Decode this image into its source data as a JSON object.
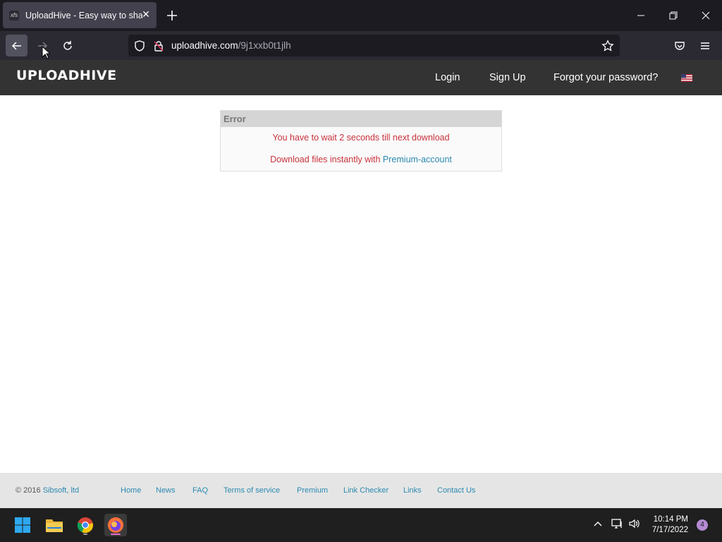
{
  "browser": {
    "tab": {
      "favicon": "xfs",
      "title": "UploadHive - Easy way to share"
    },
    "url": {
      "domain": "uploadhive.com",
      "path": "/9j1xxb0t1jlh"
    }
  },
  "site": {
    "logo": "UPLOADHIVE",
    "menu": {
      "login": "Login",
      "signup": "Sign Up",
      "forgot": "Forgot your password?"
    }
  },
  "error": {
    "heading": "Error",
    "message": "You have to wait 2 seconds till next download",
    "premium_prefix": "Download files instantly with ",
    "premium_link": "Premium-account"
  },
  "footer": {
    "copyright": "© 2016 ",
    "company": "Sibsoft, ltd",
    "links": [
      "Home",
      "News",
      "FAQ",
      "Terms of service",
      "Premium",
      "Link Checker",
      "Links",
      "Contact Us"
    ]
  },
  "taskbar": {
    "time": "10:14 PM",
    "date": "7/17/2022",
    "notifications": "4"
  }
}
